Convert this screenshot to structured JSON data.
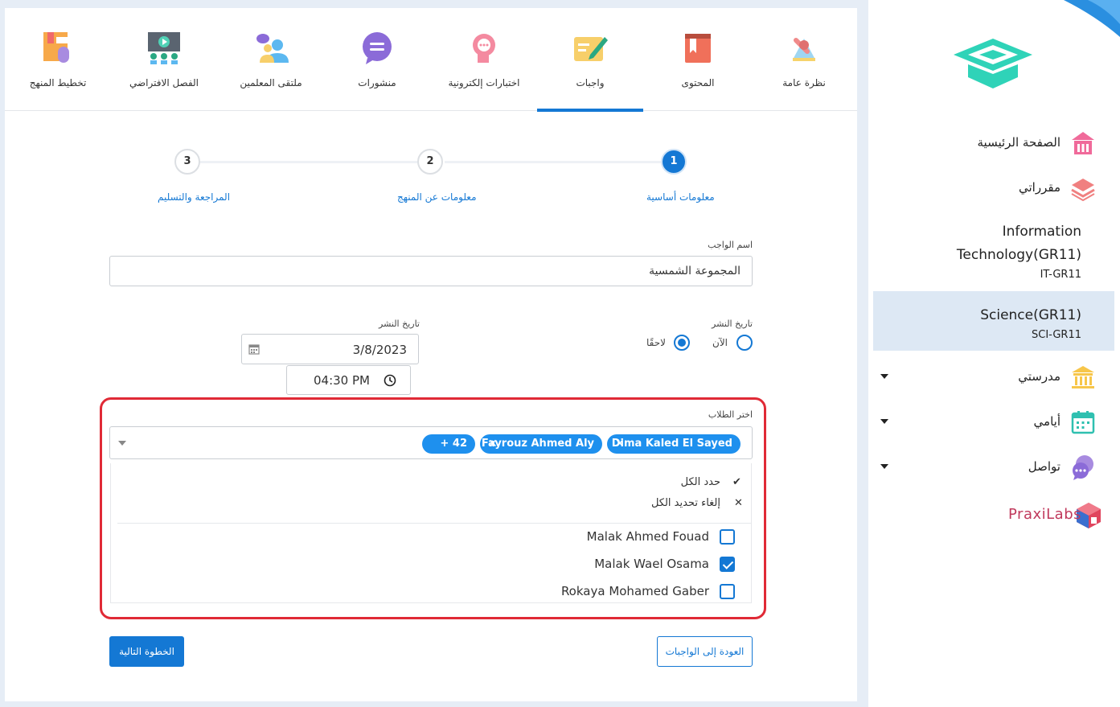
{
  "tabs": [
    {
      "label": "نظرة عامة",
      "icon": "overview-icon"
    },
    {
      "label": "المحتوى",
      "icon": "content-book-icon"
    },
    {
      "label": "واجبات",
      "icon": "assignments-icon",
      "active": true
    },
    {
      "label": "اختبارات إلكترونية",
      "icon": "quiz-icon"
    },
    {
      "label": "منشورات",
      "icon": "posts-icon"
    },
    {
      "label": "ملتقى المعلمين",
      "icon": "teachers-forum-icon"
    },
    {
      "label": "الفصل الافتراضي",
      "icon": "virtual-class-icon"
    },
    {
      "label": "تخطيط المنهج",
      "icon": "curriculum-plan-icon"
    }
  ],
  "steps": [
    {
      "num": "1",
      "label": "معلومات أساسية"
    },
    {
      "num": "2",
      "label": "معلومات عن المنهج"
    },
    {
      "num": "3",
      "label": "المراجعة والتسليم"
    }
  ],
  "form": {
    "name_label": "اسم الواجب",
    "name_value": "المجموعة الشمسية",
    "publish_label": "تاريخ النشر",
    "publish_now": "الآن",
    "publish_later": "لاحقًا",
    "publish_date_label": "تاريخ النشر",
    "publish_date": "3/8/2023",
    "publish_time": "04:30 PM",
    "students_label": "اختر الطلاب"
  },
  "students": {
    "chips": [
      "Dima Kaled El Sayed",
      "Fayrouz Ahmed Aly"
    ],
    "more": "+ 42",
    "select_all": "حدد الكل",
    "deselect_all": "إلغاء تحديد الكل",
    "options": [
      {
        "name": "Malak Ahmed Fouad",
        "checked": false
      },
      {
        "name": "Malak Wael Osama",
        "checked": true
      },
      {
        "name": "Rokaya Mohamed Gaber",
        "checked": false
      }
    ]
  },
  "buttons": {
    "next": "الخطوة التالية",
    "back": "العودة إلى الواجبات"
  },
  "sidebar": {
    "home": "الصفحة الرئيسية",
    "my_courses": "مقرراتي",
    "courses": [
      {
        "name_line1": "Information",
        "name_line2": "Technology(GR11)",
        "code": "IT-GR11"
      },
      {
        "name_line1": "Science(GR11)",
        "code": "SCI-GR11"
      }
    ],
    "my_school": "مدرستي",
    "my_days": "أيامي",
    "communicate": "تواصل",
    "praxilabs": "PraxiLabs"
  },
  "colors": {
    "accent": "#1478d4",
    "highlight": "#e02a36",
    "chip": "#1e90ee"
  }
}
